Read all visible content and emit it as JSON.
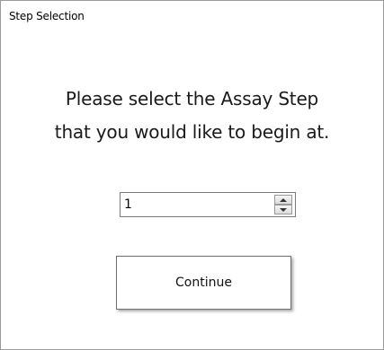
{
  "window": {
    "title": "Step Selection"
  },
  "prompt": {
    "line1": "Please select the Assay Step",
    "line2": "that you would like to begin at."
  },
  "step_spinner": {
    "value": "1"
  },
  "buttons": {
    "continue_label": "Continue"
  },
  "icons": {
    "spin_up": "triangle-up-icon",
    "spin_down": "triangle-down-icon"
  }
}
